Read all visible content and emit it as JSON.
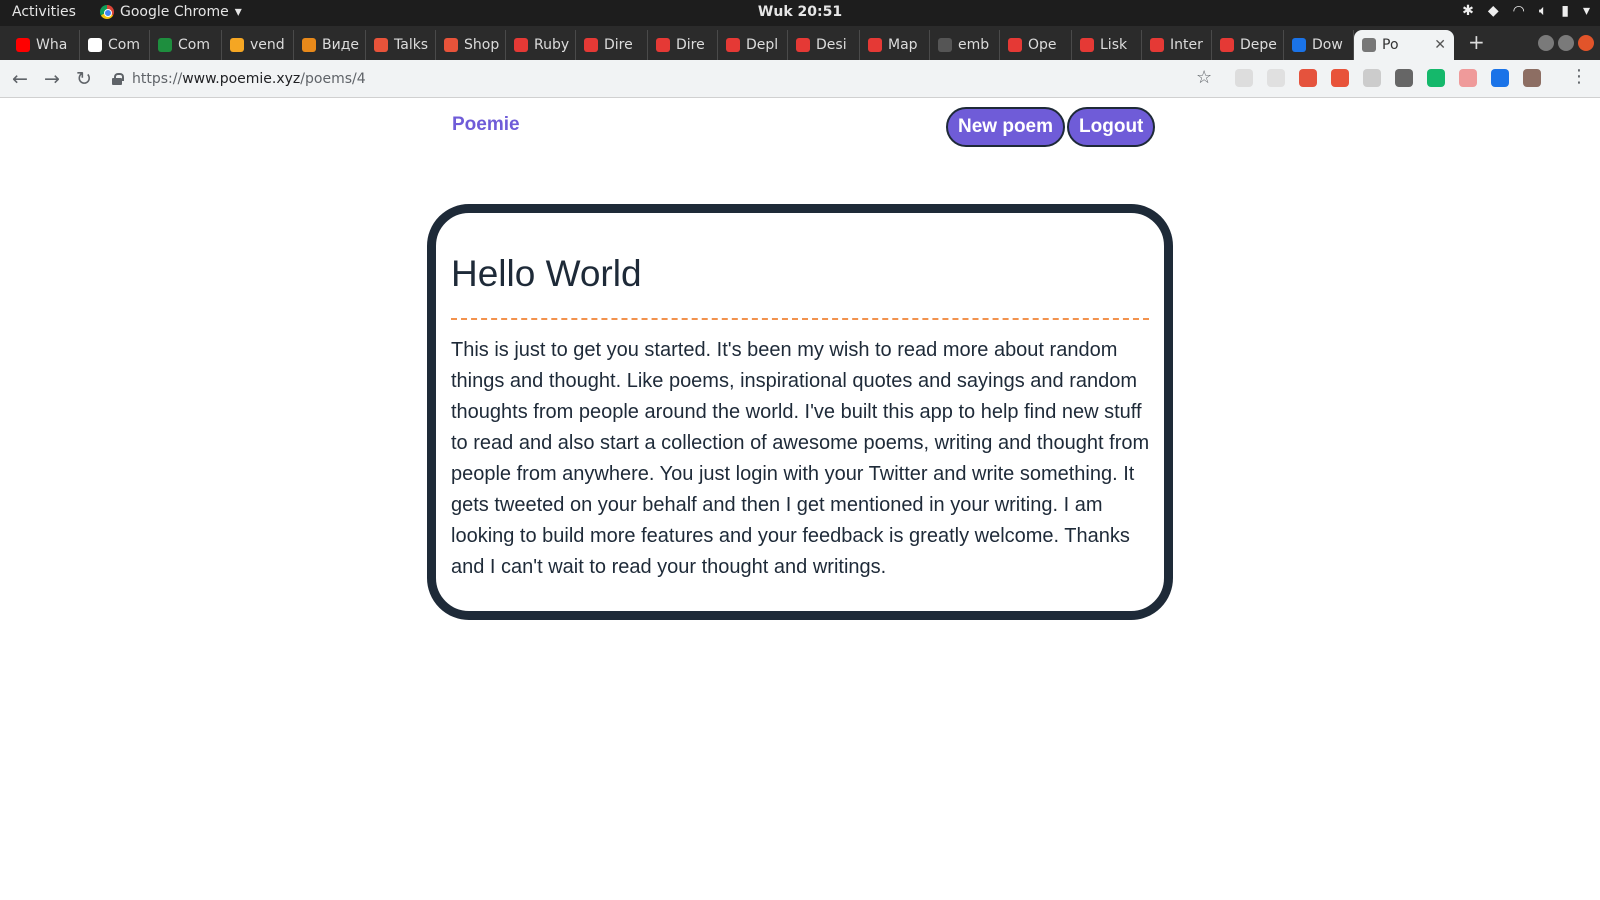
{
  "system_bar": {
    "activities": "Activities",
    "app_name": "Google Chrome",
    "clock": "Wuk 20:51",
    "tray_icons": [
      "slack-icon",
      "diamond-icon",
      "wifi-icon",
      "volume-icon",
      "battery-icon"
    ]
  },
  "tabs": [
    {
      "label": "Wha",
      "icon": "youtube-icon",
      "color": "#ff0000"
    },
    {
      "label": "Com",
      "icon": "trello-icon",
      "color": "#ffffff"
    },
    {
      "label": "Com",
      "icon": "green-icon",
      "color": "#1e8e3e"
    },
    {
      "label": "vend",
      "icon": "v-icon",
      "color": "#f5a623"
    },
    {
      "label": "Виде",
      "icon": "orange-icon",
      "color": "#e8891a"
    },
    {
      "label": "Talks",
      "icon": "p-icon",
      "color": "#e8533a"
    },
    {
      "label": "Shop",
      "icon": "p-icon",
      "color": "#e8533a"
    },
    {
      "label": "Ruby",
      "icon": "caret-icon",
      "color": "#e53935"
    },
    {
      "label": "Dire",
      "icon": "caret-icon",
      "color": "#e53935"
    },
    {
      "label": "Dire",
      "icon": "caret-icon",
      "color": "#e53935"
    },
    {
      "label": "Depl",
      "icon": "caret-icon",
      "color": "#e53935"
    },
    {
      "label": "Desi",
      "icon": "caret-icon",
      "color": "#e53935"
    },
    {
      "label": "Map",
      "icon": "caret-icon",
      "color": "#e53935"
    },
    {
      "label": "emb",
      "icon": "page-icon",
      "color": "#555555"
    },
    {
      "label": "Ope",
      "icon": "caret-icon",
      "color": "#e53935"
    },
    {
      "label": "Lisk",
      "icon": "caret-icon",
      "color": "#e53935"
    },
    {
      "label": "Inter",
      "icon": "caret-icon",
      "color": "#e53935"
    },
    {
      "label": "Depe",
      "icon": "caret-icon",
      "color": "#e53935"
    },
    {
      "label": "Dow",
      "icon": "download-icon",
      "color": "#1a73e8"
    },
    {
      "label": "Po",
      "icon": "page-icon",
      "color": "#777777",
      "active": true
    }
  ],
  "address_bar": {
    "scheme": "https://",
    "host": "www.poemie.xyz",
    "path": "/poems/4"
  },
  "extension_colors": [
    "#dddddd",
    "#e0e0e0",
    "#e5533d",
    "#e8533a",
    "#cccccc",
    "#666666",
    "#15b86b",
    "#ef9a9a",
    "#1a73e8",
    "#8d6e63"
  ],
  "site": {
    "brand": "Poemie",
    "new_poem_button": "New poem",
    "logout_button": "Logout",
    "accent_color": "#6f5cd8",
    "border_color": "#1e2a38",
    "divider_color": "#f2924e"
  },
  "poem": {
    "title": "Hello World",
    "body": "This is just to get you started. It's been my wish to read more about random things and thought. Like poems, inspirational quotes and sayings and random thoughts from people around the world. I've built this app to help find new stuff to read and also start a collection of awesome poems, writing and thought from people from anywhere. You just login with your Twitter and write something. It gets tweeted on your behalf and then I get mentioned in your writing. I am looking to build more features and your feedback is greatly welcome. Thanks and I can't wait to read your thought and writings."
  }
}
